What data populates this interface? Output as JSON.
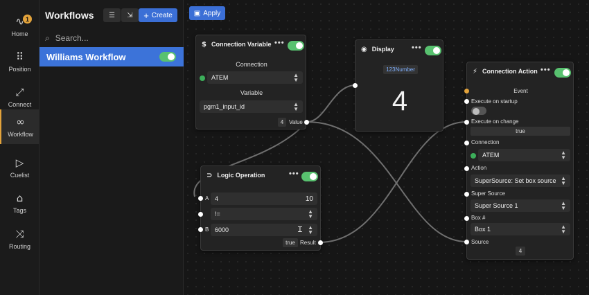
{
  "nav": {
    "items": [
      {
        "label": "Home",
        "icon": "activity-icon",
        "badge": "1"
      },
      {
        "label": "Position",
        "icon": "grid-icon"
      },
      {
        "label": "Connect",
        "icon": "connect-icon"
      },
      {
        "label": "Workflow",
        "icon": "workflow-icon"
      },
      {
        "label": "Cuelist",
        "icon": "play-icon"
      },
      {
        "label": "Tags",
        "icon": "tag-icon"
      },
      {
        "label": "Routing",
        "icon": "shuffle-icon"
      }
    ]
  },
  "panel": {
    "title": "Workflows",
    "create_label": "Create",
    "search_placeholder": "Search...",
    "workflow": "Williams Workflow"
  },
  "canvas": {
    "apply_label": "Apply"
  },
  "nodes": {
    "connection_variable": {
      "title": "Connection Variable",
      "connection_label": "Connection",
      "connection_value": "ATEM",
      "variable_label": "Variable",
      "variable_value": "pgm1_input_id",
      "value_chip": "4",
      "value_label": "Value"
    },
    "display": {
      "title": "Display",
      "type_label": "123Number",
      "value": "4"
    },
    "logic": {
      "title": "Logic Operation",
      "a_label": "A",
      "a_value": "4",
      "a_hint": "10",
      "op_value": "!=",
      "b_label": "B",
      "b_value": "6000",
      "result_chip": "true",
      "result_label": "Result"
    },
    "action": {
      "title": "Connection Action",
      "event_label": "Event",
      "exec_startup": "Execute on startup",
      "exec_change": "Execute on change",
      "exec_change_value": "true",
      "connection_label": "Connection",
      "connection_value": "ATEM",
      "action_label": "Action",
      "action_value": "SuperSource: Set box source",
      "super_source_label": "Super Source",
      "super_source_value": "Super Source 1",
      "box_label": "Box #",
      "box_value": "Box 1",
      "source_label": "Source",
      "source_value": "4"
    }
  },
  "colors": {
    "accent": "#3b6fd6",
    "toggle_on": "#58c16f",
    "badge": "#e3a33b",
    "event_port": "#e3a33b"
  }
}
